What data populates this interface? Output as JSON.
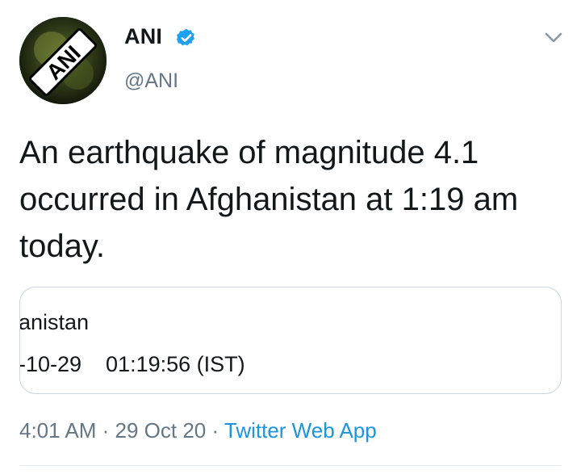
{
  "author": {
    "name": "ANI",
    "handle": "@ANI",
    "verified": true,
    "avatar_icon": "ani-logo-avatar",
    "avatar_text": "ANI"
  },
  "tweet": {
    "text": "An earthquake of magnitude 4.1 occurred in Afghanistan at 1:19 am today."
  },
  "embedded_card": {
    "line1": "anistan",
    "line2": "-10-29    01:19:56 (IST)"
  },
  "meta": {
    "time": "4:01 AM",
    "separator": " · ",
    "date": "29 Oct 20",
    "source": "Twitter Web App"
  },
  "colors": {
    "text": "#14171a",
    "secondary": "#657786",
    "accent": "#1b95e0",
    "verified_badge": "#1da1f2",
    "border": "#ccd6dd"
  }
}
